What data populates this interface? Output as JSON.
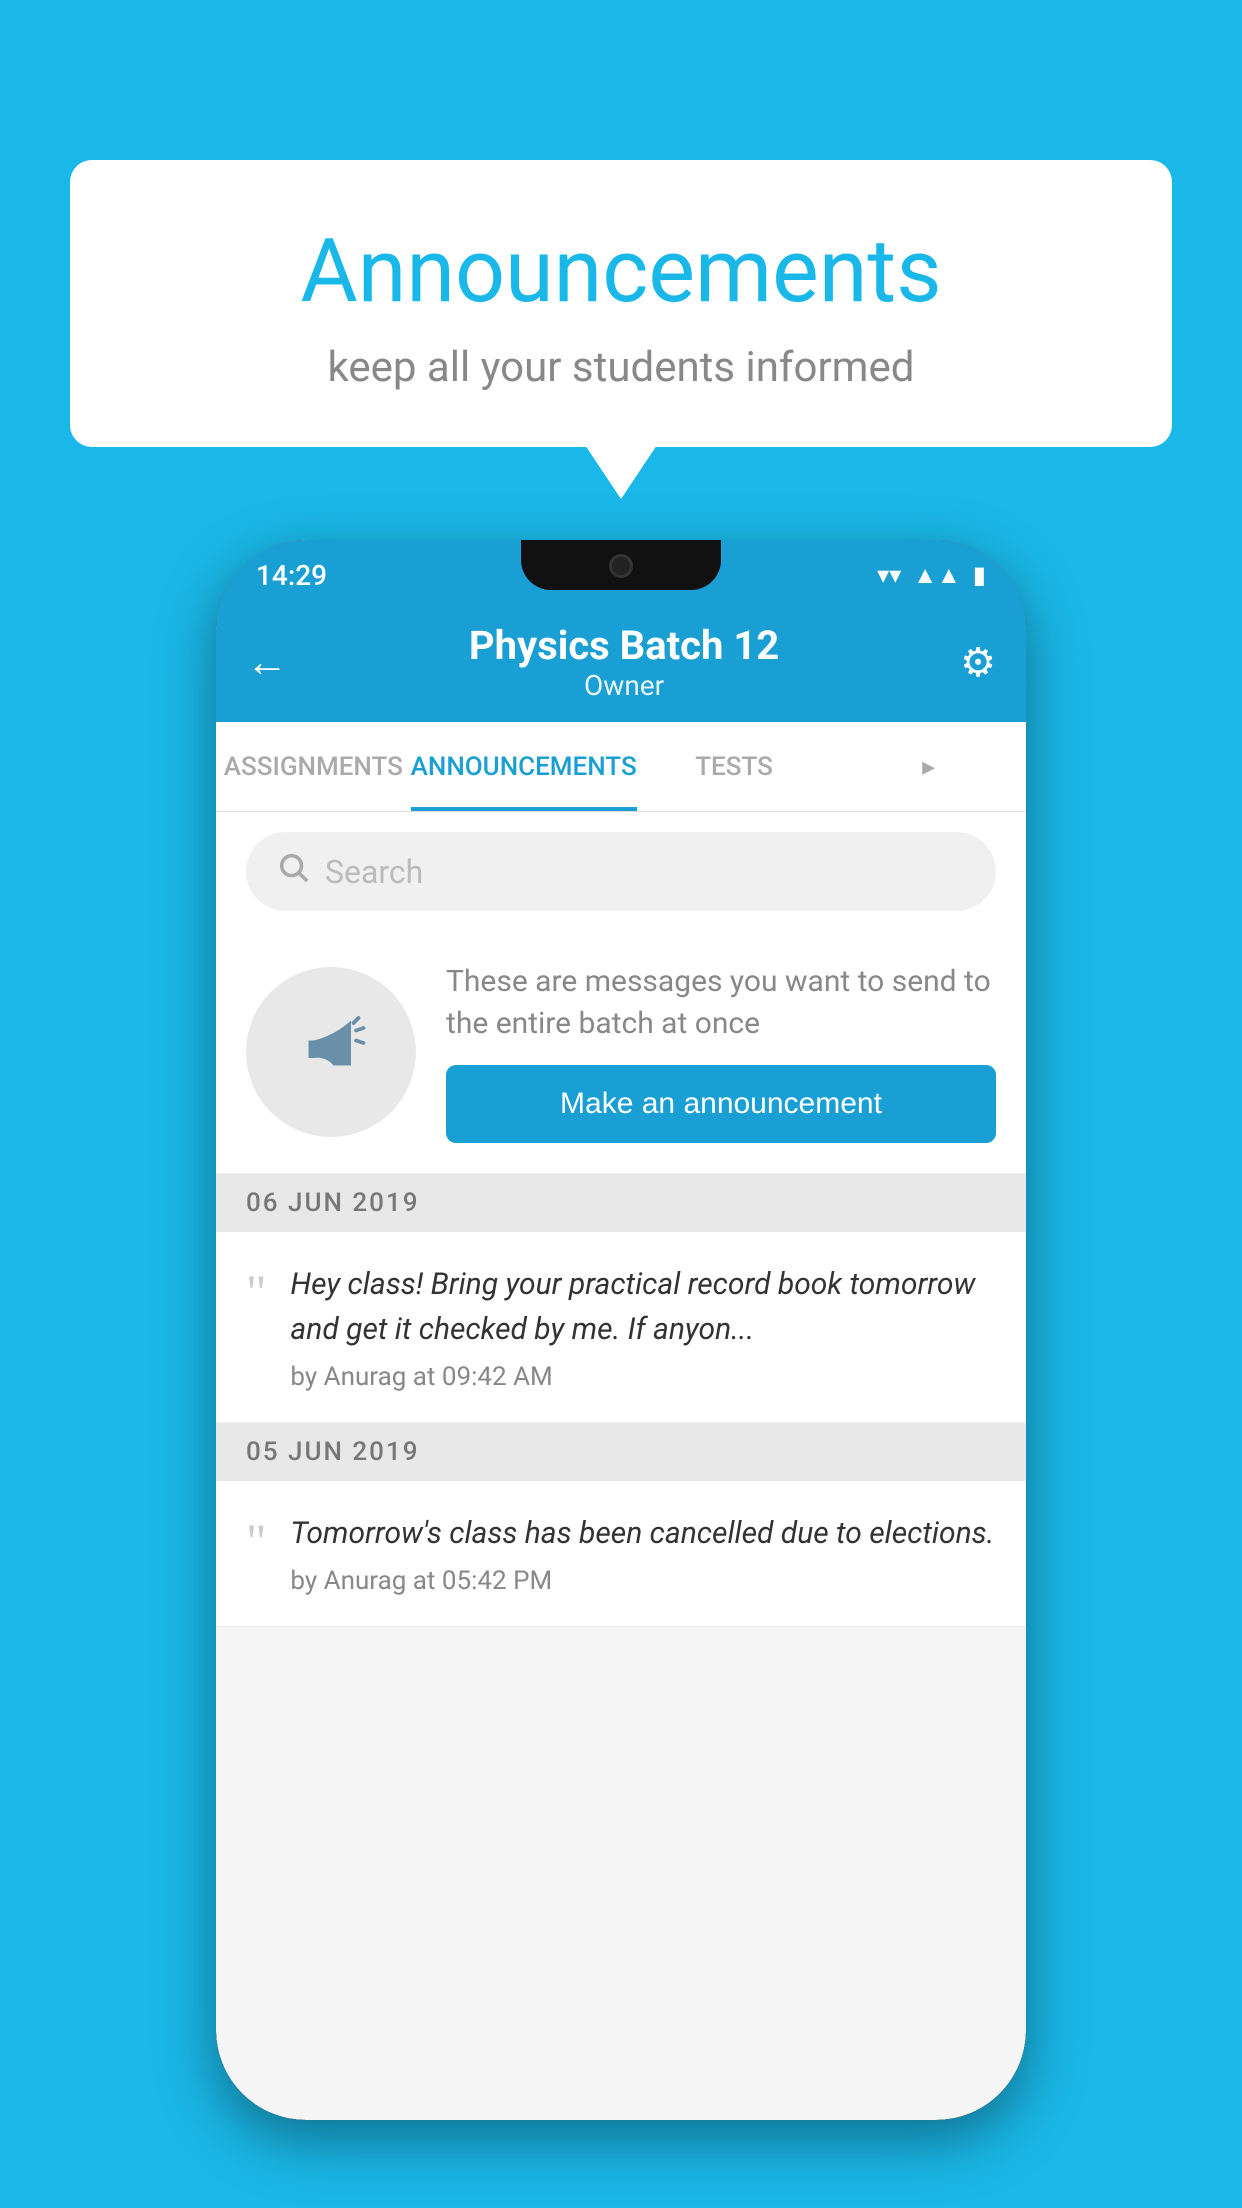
{
  "page": {
    "background_color": "#1ab8e8"
  },
  "speech_bubble": {
    "title": "Announcements",
    "subtitle": "keep all your students informed"
  },
  "status_bar": {
    "time": "14:29",
    "wifi_icon": "▼",
    "signal_icon": "◄",
    "battery_icon": "▮"
  },
  "header": {
    "back_label": "←",
    "title": "Physics Batch 12",
    "subtitle": "Owner",
    "settings_label": "⚙"
  },
  "tabs": [
    {
      "label": "ASSIGNMENTS",
      "active": false
    },
    {
      "label": "ANNOUNCEMENTS",
      "active": true
    },
    {
      "label": "TESTS",
      "active": false
    },
    {
      "label": "...",
      "active": false
    }
  ],
  "search": {
    "placeholder": "Search"
  },
  "cta": {
    "description": "These are messages you want to send to the entire batch at once",
    "button_label": "Make an announcement"
  },
  "announcements": [
    {
      "date": "06  JUN  2019",
      "text": "Hey class! Bring your practical record book tomorrow and get it checked by me. If anyon...",
      "meta": "by Anurag at 09:42 AM"
    },
    {
      "date": "05  JUN  2019",
      "text": "Tomorrow's class has been cancelled due to elections.",
      "meta": "by Anurag at 05:42 PM"
    }
  ]
}
